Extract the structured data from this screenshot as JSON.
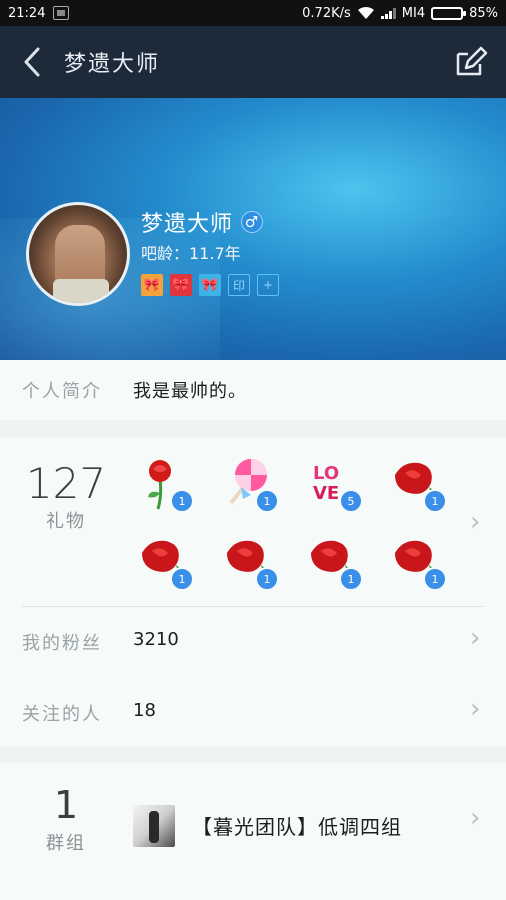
{
  "status_bar": {
    "time": "21:24",
    "network_speed": "0.72K/s",
    "carrier": "MI4",
    "battery": "85%",
    "battery_level": 0.85,
    "icons": [
      "image-icon",
      "wifi-icon",
      "signal-icon",
      "battery-icon"
    ]
  },
  "header": {
    "title": "梦遗大师",
    "back_icon": "back-icon",
    "edit_icon": "edit-icon"
  },
  "profile": {
    "name": "梦遗大师",
    "gender_icon": "male-icon",
    "gender_symbol": "♂",
    "age_text": "吧龄：11.7年",
    "badges": [
      {
        "name": "orange-bow-badge",
        "glyph": "🎀",
        "color": "#f3a23c"
      },
      {
        "name": "red-bow-badge",
        "glyph": "🎀",
        "color": "#e0353b"
      },
      {
        "name": "blue-bow-badge",
        "glyph": "🎀",
        "color": "#3fb2e8"
      },
      {
        "name": "seal-badge",
        "glyph": "印"
      },
      {
        "name": "add-badge",
        "glyph": "+"
      }
    ]
  },
  "intro": {
    "label": "个人简介",
    "value": "我是最帅的。"
  },
  "gifts": {
    "count": "127",
    "label": "礼物",
    "items": [
      {
        "type": "rose-icon",
        "count": "1"
      },
      {
        "type": "lollipop-icon",
        "count": "1"
      },
      {
        "type": "love-icon",
        "count": "5"
      },
      {
        "type": "rose-bunch-icon",
        "count": "1"
      },
      {
        "type": "rose-bunch-icon",
        "count": "1"
      },
      {
        "type": "rose-bunch-icon",
        "count": "1"
      },
      {
        "type": "rose-bunch-icon",
        "count": "1"
      },
      {
        "type": "rose-bunch-icon",
        "count": "1"
      }
    ]
  },
  "fans": {
    "label": "我的粉丝",
    "value": "3210"
  },
  "following": {
    "label": "关注的人",
    "value": "18"
  },
  "groups": {
    "count": "1",
    "label": "群组",
    "items": [
      {
        "name": "【暮光团队】低调四组"
      }
    ]
  },
  "colors": {
    "header_bg": "#1d2a3a",
    "banner_accent": "#238ccd",
    "badge_count": "#3a8fe8",
    "card_bg": "#f6faf9"
  }
}
